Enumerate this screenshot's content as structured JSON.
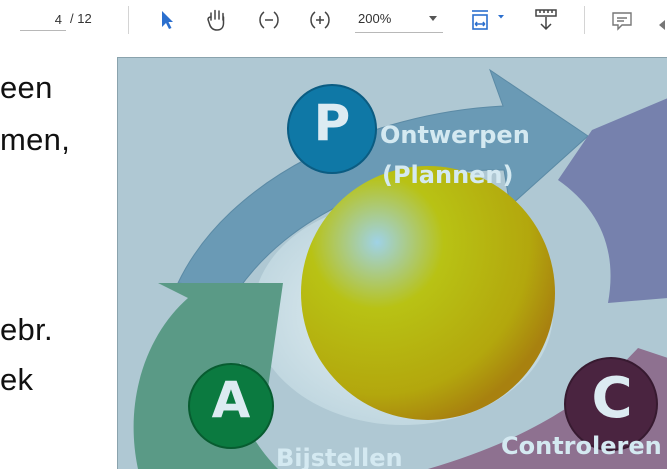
{
  "toolbar": {
    "page_current": "4",
    "page_total": "/ 12",
    "zoom_value": "200%",
    "icons": [
      "select-pointer-icon",
      "hand-tool-icon",
      "zoom-out-icon",
      "zoom-in-icon",
      "zoom-dropdown-icon",
      "fit-page-icon",
      "scroll-mode-icon",
      "comment-icon"
    ],
    "accent_color": "#2b6fce"
  },
  "document": {
    "lines": [
      "een",
      "men,",
      "ebr.",
      "ek"
    ]
  },
  "figure": {
    "labels": {
      "ontwerpen": "Ontwerpen",
      "plannen": "(Plannen)",
      "bijstellen": "Bijstellen",
      "controleren": "Controleren"
    },
    "badges": {
      "p": "P",
      "a": "A",
      "c": "C"
    },
    "colors": {
      "background": "#afc8d3",
      "arrow_top": "#6a9ab5",
      "arrow_left": "#5a9a86",
      "arrow_right": "#7681ad",
      "arrow_bottom": "#8e7190",
      "badge_p": "#0f78a6",
      "badge_a": "#0b7a40",
      "badge_c": "#4a2440",
      "sphere": "#b4b40e"
    }
  }
}
